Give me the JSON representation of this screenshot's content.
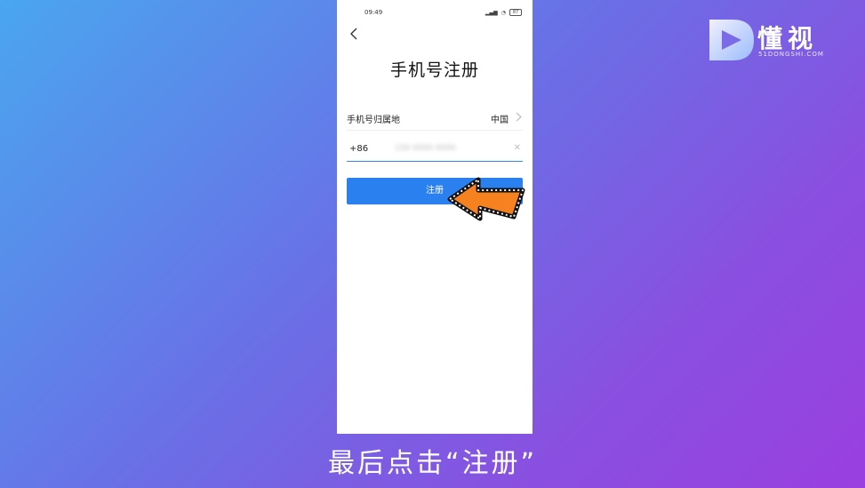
{
  "status_bar": {
    "time": "09:49",
    "battery": "87"
  },
  "page": {
    "title": "手机号注册"
  },
  "region_row": {
    "label": "手机号归属地",
    "value": "中国"
  },
  "phone_row": {
    "country_code": "+86",
    "number_masked": "150 0000 0000"
  },
  "register_button": {
    "label": "注册"
  },
  "caption": "最后点击“注册”",
  "watermark": {
    "brand": "懂视",
    "domain": "51DONGSHI.COM"
  },
  "colors": {
    "accent": "#2b80f0",
    "arrow": "#f5821f"
  },
  "icons": [
    "back-chevron-icon",
    "chevron-right-icon",
    "clear-icon",
    "pointer-arrow-icon",
    "logo-icon"
  ]
}
